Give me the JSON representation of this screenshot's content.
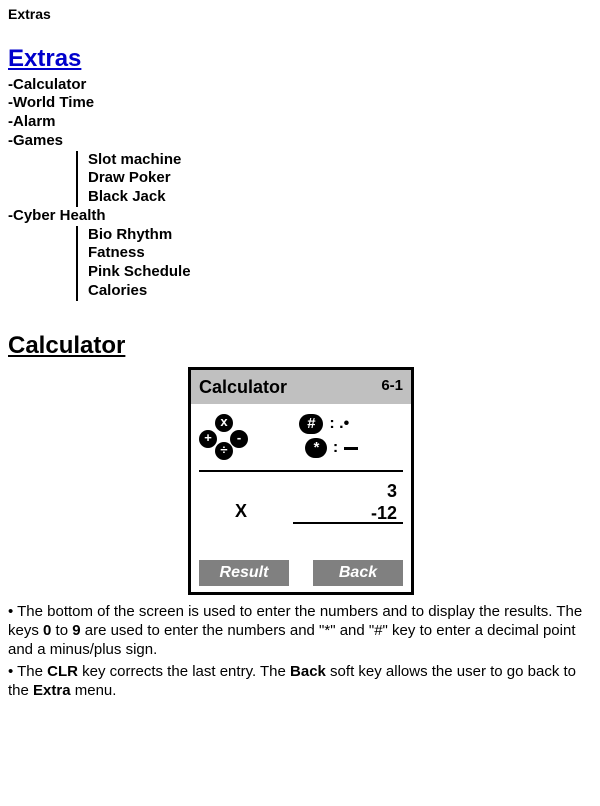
{
  "page_small_title": "Extras",
  "section_title": "Extras",
  "menu": {
    "items": [
      "-Calculator",
      "-World Time",
      "-Alarm",
      "-Games"
    ],
    "games_sub": [
      "Slot machine",
      "Draw Poker",
      "Black Jack"
    ],
    "cyber_label": "-Cyber Health",
    "cyber_sub": [
      "Bio Rhythm",
      "Fatness",
      "Pink Schedule",
      "Calories"
    ]
  },
  "calculator_heading": "Calculator",
  "calc": {
    "title": "Calculator",
    "index": "6-1",
    "cross": {
      "top": "x",
      "left": "+",
      "right": "-",
      "bottom": "÷"
    },
    "hash_key": "#",
    "hash_legend": ": .•",
    "star_key": "*",
    "star_legend": ":",
    "entry_top": "3",
    "op": "X",
    "entry_bottom": "-12",
    "soft_left": "Result",
    "soft_right": "Back"
  },
  "paragraphs": {
    "p1a": "• The bottom of the screen is used to enter the numbers and to display the results. The keys ",
    "p1b": "0",
    "p1c": " to ",
    "p1d": "9",
    "p1e": " are used to enter the numbers and \"*\" and \"#\" key to enter a decimal point and a minus/plus sign.",
    "p2a": "• The ",
    "p2b": "CLR",
    "p2c": " key corrects the last entry. The ",
    "p2d": "Back",
    "p2e": " soft key allows the user to go back to the ",
    "p2f": "Extra",
    "p2g": " menu."
  }
}
